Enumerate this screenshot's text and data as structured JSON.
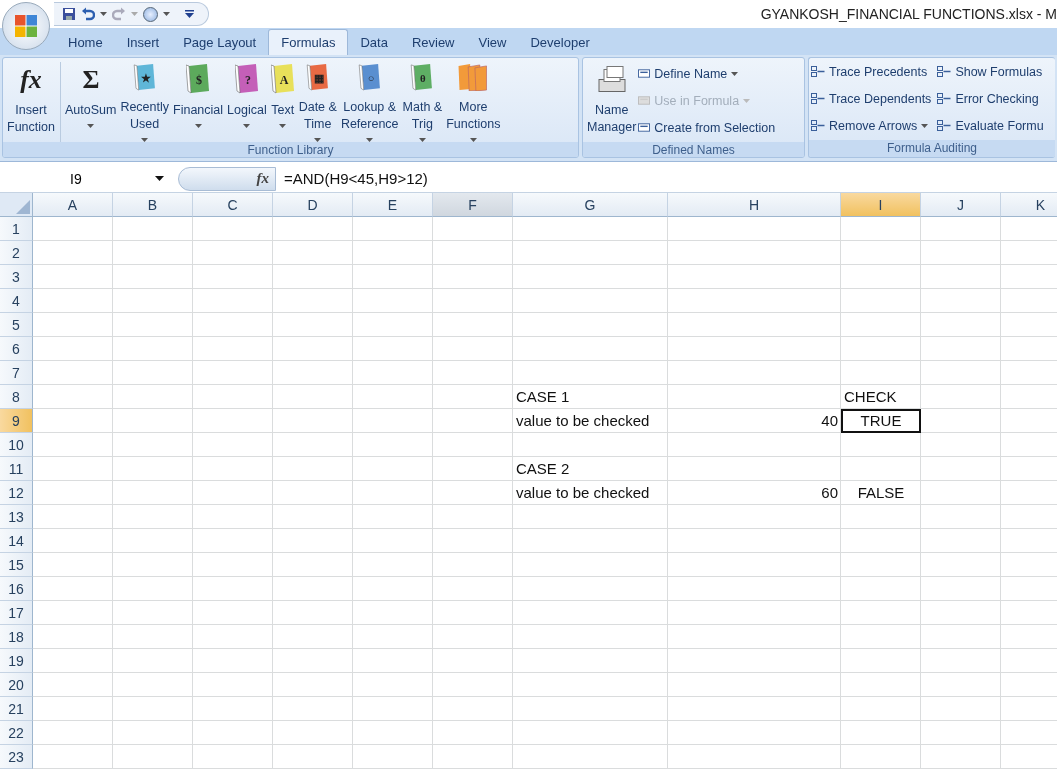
{
  "window": {
    "title": "GYANKOSH_FINANCIAL FUNCTIONS.xlsx - M"
  },
  "tabs": [
    {
      "label": "Home",
      "selected": false
    },
    {
      "label": "Insert",
      "selected": false
    },
    {
      "label": "Page Layout",
      "selected": false
    },
    {
      "label": "Formulas",
      "selected": true
    },
    {
      "label": "Data",
      "selected": false
    },
    {
      "label": "Review",
      "selected": false
    },
    {
      "label": "View",
      "selected": false
    },
    {
      "label": "Developer",
      "selected": false
    }
  ],
  "function_library": {
    "title": "Function Library",
    "buttons": [
      {
        "lines": [
          "Insert",
          "Function"
        ],
        "kind": "glyph",
        "glyph": "fx",
        "dropdown": false
      },
      {
        "lines": [
          "AutoSum"
        ],
        "kind": "glyph",
        "glyph": "Σ",
        "dropdown": true
      },
      {
        "lines": [
          "Recently",
          "Used"
        ],
        "kind": "book",
        "color": "#5fb6d8",
        "glyph": "★",
        "dropdown": true
      },
      {
        "lines": [
          "Financial"
        ],
        "kind": "book",
        "color": "#5caa5c",
        "glyph": "$",
        "dropdown": true
      },
      {
        "lines": [
          "Logical"
        ],
        "kind": "book",
        "color": "#c45fb8",
        "glyph": "?",
        "dropdown": true
      },
      {
        "lines": [
          "Text"
        ],
        "kind": "book",
        "color": "#e8e05a",
        "glyph": "A",
        "dropdown": true
      },
      {
        "lines": [
          "Date &",
          "Time"
        ],
        "kind": "book",
        "color": "#e86a44",
        "glyph": "▦",
        "dropdown": true
      },
      {
        "lines": [
          "Lookup &",
          "Reference"
        ],
        "kind": "book",
        "color": "#5a8fd0",
        "glyph": "○",
        "dropdown": true
      },
      {
        "lines": [
          "Math &",
          "Trig"
        ],
        "kind": "book",
        "color": "#5eae64",
        "glyph": "θ",
        "dropdown": true
      },
      {
        "lines": [
          "More",
          "Functions"
        ],
        "kind": "books",
        "color": "#f29a3a",
        "dropdown": true
      }
    ]
  },
  "defined_names": {
    "title": "Defined Names",
    "big": {
      "lines": [
        "Name",
        "Manager"
      ]
    },
    "items": [
      {
        "label": "Define Name",
        "dropdown": true,
        "disabled": false
      },
      {
        "label": "Use in Formula",
        "dropdown": true,
        "disabled": true
      },
      {
        "label": "Create from Selection",
        "dropdown": false,
        "disabled": false
      }
    ]
  },
  "formula_auditing": {
    "title": "Formula Auditing",
    "items": [
      {
        "label": "Trace Precedents",
        "dropdown": false
      },
      {
        "label": "Trace Dependents",
        "dropdown": false
      },
      {
        "label": "Remove Arrows",
        "dropdown": true
      },
      {
        "label": "Show Formulas",
        "dropdown": false
      },
      {
        "label": "Error Checking",
        "dropdown": false
      },
      {
        "label": "Evaluate Formu",
        "dropdown": false
      }
    ]
  },
  "formula_bar": {
    "name_box": "I9",
    "fx": "fx",
    "formula": "=AND(H9<45,H9>12)"
  },
  "columns": [
    {
      "label": "A",
      "selected": false,
      "hovered": false
    },
    {
      "label": "B",
      "selected": false,
      "hovered": false
    },
    {
      "label": "C",
      "selected": false,
      "hovered": false
    },
    {
      "label": "D",
      "selected": false,
      "hovered": false
    },
    {
      "label": "E",
      "selected": false,
      "hovered": false
    },
    {
      "label": "F",
      "selected": false,
      "hovered": true
    },
    {
      "label": "G",
      "selected": false,
      "hovered": false
    },
    {
      "label": "H",
      "selected": false,
      "hovered": false
    },
    {
      "label": "I",
      "selected": true,
      "hovered": false
    },
    {
      "label": "J",
      "selected": false,
      "hovered": false
    },
    {
      "label": "K",
      "selected": false,
      "hovered": false
    }
  ],
  "rows": [
    {
      "label": "1",
      "selected": false,
      "cells": {}
    },
    {
      "label": "2",
      "selected": false,
      "cells": {}
    },
    {
      "label": "3",
      "selected": false,
      "cells": {}
    },
    {
      "label": "4",
      "selected": false,
      "cells": {}
    },
    {
      "label": "5",
      "selected": false,
      "cells": {}
    },
    {
      "label": "6",
      "selected": false,
      "cells": {}
    },
    {
      "label": "7",
      "selected": false,
      "cells": {}
    },
    {
      "label": "8",
      "selected": false,
      "cells": {
        "G": {
          "text": "CASE 1",
          "kind": "text",
          "active": false
        },
        "I": {
          "text": "CHECK",
          "kind": "text",
          "active": false
        }
      }
    },
    {
      "label": "9",
      "selected": true,
      "cells": {
        "G": {
          "text": "value to be checked",
          "kind": "text",
          "active": false
        },
        "H": {
          "text": "40",
          "kind": "number",
          "active": false
        },
        "I": {
          "text": "TRUE",
          "kind": "boolean",
          "active": true
        }
      }
    },
    {
      "label": "10",
      "selected": false,
      "cells": {}
    },
    {
      "label": "11",
      "selected": false,
      "cells": {
        "G": {
          "text": "CASE 2",
          "kind": "text",
          "active": false
        }
      }
    },
    {
      "label": "12",
      "selected": false,
      "cells": {
        "G": {
          "text": "value to be checked",
          "kind": "text",
          "active": false
        },
        "H": {
          "text": "60",
          "kind": "number",
          "active": false
        },
        "I": {
          "text": "FALSE",
          "kind": "boolean",
          "active": false
        }
      }
    },
    {
      "label": "13",
      "selected": false,
      "cells": {}
    },
    {
      "label": "14",
      "selected": false,
      "cells": {}
    },
    {
      "label": "15",
      "selected": false,
      "cells": {}
    },
    {
      "label": "16",
      "selected": false,
      "cells": {}
    },
    {
      "label": "17",
      "selected": false,
      "cells": {}
    },
    {
      "label": "18",
      "selected": false,
      "cells": {}
    },
    {
      "label": "19",
      "selected": false,
      "cells": {}
    },
    {
      "label": "20",
      "selected": false,
      "cells": {}
    },
    {
      "label": "21",
      "selected": false,
      "cells": {}
    },
    {
      "label": "22",
      "selected": false,
      "cells": {}
    },
    {
      "label": "23",
      "selected": false,
      "cells": {}
    }
  ]
}
